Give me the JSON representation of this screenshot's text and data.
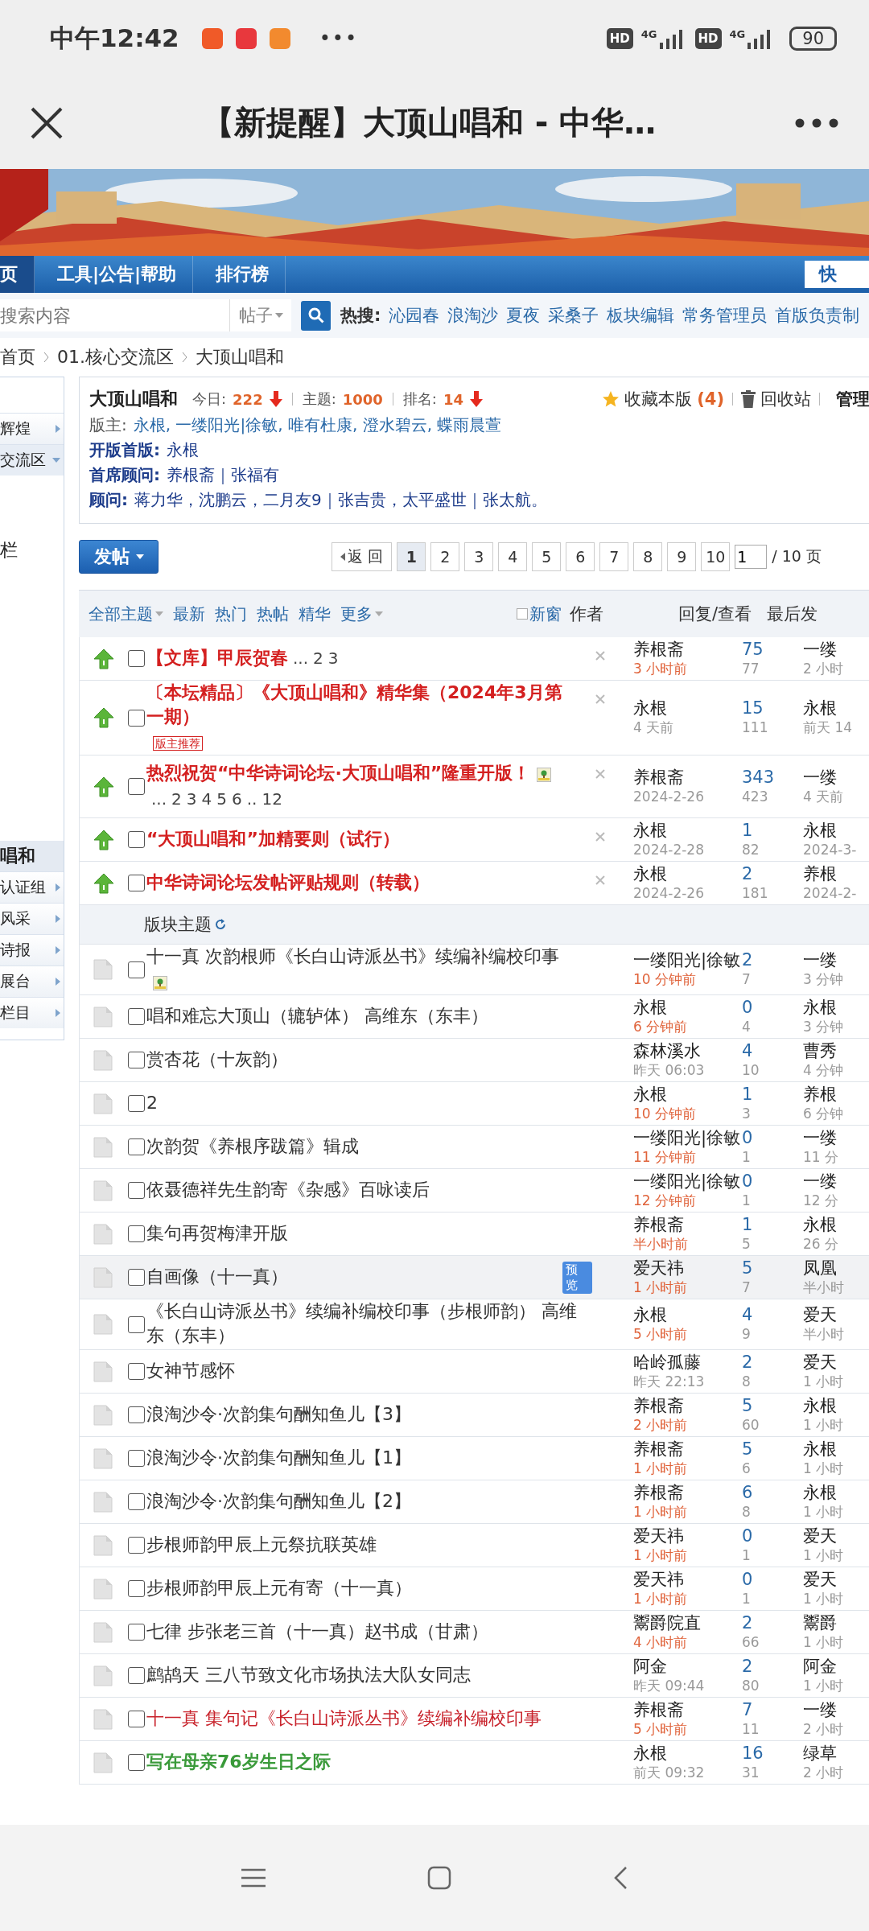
{
  "status_bar": {
    "time": "中午12:42",
    "more": "•••",
    "hd": [
      "HD",
      "HD"
    ],
    "network": [
      "4G",
      "4G"
    ],
    "battery": "90"
  },
  "browser": {
    "title": "【新提醒】大顶山唱和 - 中华…"
  },
  "nav": {
    "items": [
      {
        "label": "页",
        "selected": true
      },
      {
        "label": "工具|公告|帮助",
        "selected": false
      },
      {
        "label": "排行榜",
        "selected": false
      }
    ],
    "quick": "快"
  },
  "search": {
    "placeholder": "搜索内容",
    "type": "帖子",
    "hot_label": "热搜:",
    "hot": [
      "沁园春",
      "浪淘沙",
      "夏夜",
      "采桑子",
      "板块编辑",
      "常务管理员",
      "首版负责制"
    ]
  },
  "breadcrumb": [
    "首页",
    "01.核心交流区",
    "大顶山唱和"
  ],
  "sidebar": {
    "groups_top": [
      {
        "label": "辉煌",
        "expanded": false
      },
      {
        "label": "交流区",
        "expanded": true
      }
    ],
    "sub_items": [
      {
        "label": "栏",
        "selected": false
      },
      {
        "label": "唱和",
        "selected": true
      }
    ],
    "groups_bottom": [
      {
        "label": "认证组",
        "expanded": false
      },
      {
        "label": "风采",
        "expanded": false
      },
      {
        "label": "诗报",
        "expanded": false
      },
      {
        "label": "展台",
        "expanded": false
      },
      {
        "label": "栏目",
        "expanded": false
      }
    ]
  },
  "forum": {
    "name": "大顶山唱和",
    "today_label": "今日:",
    "today": "222",
    "topics_label": "主题:",
    "topics": "1000",
    "rank_label": "排名:",
    "rank": "14",
    "favorite": "收藏本版",
    "favorite_count": "(4)",
    "recycle": "回收站",
    "manage": "管理",
    "moderators_label": "版主:",
    "moderators": "永根, 一缕阳光|徐敏, 唯有杜康, 澄水碧云, 蝶雨晨萱",
    "founder_label": "开版首版:",
    "founder": "永根",
    "chief_label": "首席顾问:",
    "chief": "养根斋｜张福有",
    "advisors_label": "顾问:",
    "advisors": "蒋力华，沈鹏云，二月友9｜张吉贵，太平盛世｜张太航。"
  },
  "post_button": "发帖",
  "pager": {
    "back": "返 回",
    "pages": [
      {
        "label": "1",
        "selected": true
      },
      {
        "label": "2",
        "selected": false
      },
      {
        "label": "3",
        "selected": false
      },
      {
        "label": "4",
        "selected": false
      },
      {
        "label": "5",
        "selected": false
      },
      {
        "label": "6",
        "selected": false
      },
      {
        "label": "7",
        "selected": false
      },
      {
        "label": "8",
        "selected": false
      },
      {
        "label": "9",
        "selected": false
      },
      {
        "label": "10",
        "selected": false
      }
    ],
    "current": "1",
    "total": "/ 10 页"
  },
  "filters": [
    {
      "label": "全部主题",
      "dropdown": true
    },
    {
      "label": "最新",
      "dropdown": false
    },
    {
      "label": "热门",
      "dropdown": false
    },
    {
      "label": "热帖",
      "dropdown": false
    },
    {
      "label": "精华",
      "dropdown": false
    },
    {
      "label": "更多",
      "dropdown": true
    }
  ],
  "new_window": {
    "label": "新窗",
    "checked": false
  },
  "columns": {
    "author": "作者",
    "replies": "回复/查看",
    "last": "最后发"
  },
  "sticky_threads": [
    {
      "title": "【文库】甲辰贺春",
      "color": "#d42020",
      "bold": true,
      "pages": [
        "...",
        "2",
        "3"
      ],
      "author": "养根斋",
      "time": "3 小时前",
      "recent": true,
      "replies": "75",
      "views": "77",
      "last_author": "一缕",
      "last_time": "2 小时",
      "highlighted": false
    },
    {
      "title": "〔本坛精品〕《大顶山唱和》精华集（2024年3月第一期）",
      "color": "#d42020",
      "bold": true,
      "badge": {
        "kind": "recommend",
        "label": "版主推荐"
      },
      "author": "永根",
      "time": "4 天前",
      "recent": false,
      "replies": "15",
      "views": "111",
      "last_author": "永根",
      "last_time": "前天 14",
      "highlighted": false
    },
    {
      "title": "热烈祝贺“中华诗词论坛·大顶山唱和”隆重开版！",
      "color": "#d42020",
      "bold": true,
      "image": true,
      "pages": [
        "...",
        "2",
        "3",
        "4",
        "5",
        "6",
        "..",
        "12"
      ],
      "author": "养根斋",
      "time": "2024-2-26",
      "recent": false,
      "replies": "343",
      "views": "423",
      "last_author": "一缕",
      "last_time": "4 天前",
      "highlighted": false
    },
    {
      "title": "“大顶山唱和”加精要则（试行）",
      "color": "#d42020",
      "bold": true,
      "author": "永根",
      "time": "2024-2-28",
      "recent": false,
      "replies": "1",
      "views": "82",
      "last_author": "永根",
      "last_time": "2024-3-",
      "highlighted": false
    },
    {
      "title": "中华诗词论坛发帖评贴规则（转载）",
      "color": "#d42020",
      "bold": true,
      "author": "永根",
      "time": "2024-2-26",
      "recent": false,
      "replies": "2",
      "views": "181",
      "last_author": "养根",
      "last_time": "2024-2-",
      "highlighted": false
    }
  ],
  "section": "版块主题",
  "threads": [
    {
      "title": "十一真 次韵根师《长白山诗派丛书》续编补编校印事",
      "color": "#333333",
      "bold": false,
      "image": true,
      "author": "一缕阳光|徐敏",
      "time": "10 分钟前",
      "recent": true,
      "replies": "2",
      "views": "7",
      "last_author": "一缕",
      "last_time": "3 分钟",
      "highlighted": false
    },
    {
      "title": "唱和难忘大顶山（辘轳体） 高维东（东丰）",
      "color": "#333333",
      "bold": false,
      "author": "永根",
      "time": "6 分钟前",
      "recent": true,
      "replies": "0",
      "views": "4",
      "last_author": "永根",
      "last_time": "3 分钟",
      "highlighted": false
    },
    {
      "title": "赏杏花（十灰韵）",
      "color": "#333333",
      "bold": false,
      "author": "森林溪水",
      "time": "昨天 06:03",
      "recent": false,
      "replies": "4",
      "views": "10",
      "last_author": "曹秀",
      "last_time": "4 分钟",
      "highlighted": false
    },
    {
      "title": "2",
      "color": "#333333",
      "bold": false,
      "author": "永根",
      "time": "10 分钟前",
      "recent": true,
      "replies": "1",
      "views": "3",
      "last_author": "养根",
      "last_time": "6 分钟",
      "highlighted": false
    },
    {
      "title": "次韵贺《养根序跋篇》辑成",
      "color": "#333333",
      "bold": false,
      "author": "一缕阳光|徐敏",
      "time": "11 分钟前",
      "recent": true,
      "replies": "0",
      "views": "1",
      "last_author": "一缕",
      "last_time": "11 分",
      "highlighted": false
    },
    {
      "title": "依聂德祥先生韵寄《杂感》百咏读后",
      "color": "#333333",
      "bold": false,
      "author": "一缕阳光|徐敏",
      "time": "12 分钟前",
      "recent": true,
      "replies": "0",
      "views": "1",
      "last_author": "一缕",
      "last_time": "12 分",
      "highlighted": false
    },
    {
      "title": "集句再贺梅津开版",
      "color": "#333333",
      "bold": false,
      "author": "养根斋",
      "time": "半小时前",
      "recent": true,
      "replies": "1",
      "views": "5",
      "last_author": "永根",
      "last_time": "26 分",
      "highlighted": false
    },
    {
      "title": "自画像（十一真）",
      "color": "#333333",
      "bold": false,
      "badge": {
        "kind": "preview",
        "label": "预览"
      },
      "author": "爱天祎",
      "time": "1 小时前",
      "recent": true,
      "replies": "5",
      "views": "7",
      "last_author": "凤凰",
      "last_time": "半小时",
      "highlighted": true
    },
    {
      "title": "《长白山诗派丛书》续编补编校印事（步根师韵） 高维东（东丰）",
      "color": "#333333",
      "bold": false,
      "author": "永根",
      "time": "5 小时前",
      "recent": true,
      "replies": "4",
      "views": "9",
      "last_author": "爱天",
      "last_time": "半小时",
      "highlighted": false
    },
    {
      "title": "女神节感怀",
      "color": "#333333",
      "bold": false,
      "author": "哈岭孤藤",
      "time": "昨天 22:13",
      "recent": false,
      "replies": "2",
      "views": "8",
      "last_author": "爱天",
      "last_time": "1 小时",
      "highlighted": false
    },
    {
      "title": "浪淘沙令·次韵集句酬知鱼儿【3】",
      "color": "#333333",
      "bold": false,
      "author": "养根斋",
      "time": "2 小时前",
      "recent": true,
      "replies": "5",
      "views": "60",
      "last_author": "永根",
      "last_time": "1 小时",
      "highlighted": false
    },
    {
      "title": "浪淘沙令·次韵集句酬知鱼儿【1】",
      "color": "#333333",
      "bold": false,
      "author": "养根斋",
      "time": "1 小时前",
      "recent": true,
      "replies": "5",
      "views": "6",
      "last_author": "永根",
      "last_time": "1 小时",
      "highlighted": false
    },
    {
      "title": "浪淘沙令·次韵集句酬知鱼儿【2】",
      "color": "#333333",
      "bold": false,
      "author": "养根斋",
      "time": "1 小时前",
      "recent": true,
      "replies": "6",
      "views": "8",
      "last_author": "永根",
      "last_time": "1 小时",
      "highlighted": false
    },
    {
      "title": "步根师韵甲辰上元祭抗联英雄",
      "color": "#333333",
      "bold": false,
      "author": "爱天祎",
      "time": "1 小时前",
      "recent": true,
      "replies": "0",
      "views": "1",
      "last_author": "爱天",
      "last_time": "1 小时",
      "highlighted": false
    },
    {
      "title": "步根师韵甲辰上元有寄（十一真）",
      "color": "#333333",
      "bold": false,
      "author": "爱天祎",
      "time": "1 小时前",
      "recent": true,
      "replies": "0",
      "views": "1",
      "last_author": "爱天",
      "last_time": "1 小时",
      "highlighted": false
    },
    {
      "title": "七律 步张老三首（十一真）赵书成（甘肃）",
      "color": "#333333",
      "bold": false,
      "author": "鬻爵院直",
      "time": "4 小时前",
      "recent": true,
      "replies": "2",
      "views": "66",
      "last_author": "鬻爵",
      "last_time": "1 小时",
      "highlighted": false
    },
    {
      "title": "鹧鸪天 三八节致文化市场执法大队女同志",
      "color": "#333333",
      "bold": false,
      "author": "阿金",
      "time": "昨天 09:44",
      "recent": false,
      "replies": "2",
      "views": "80",
      "last_author": "阿金",
      "last_time": "1 小时",
      "highlighted": false
    },
    {
      "title": "十一真 集句记《长白山诗派丛书》续编补编校印事",
      "color": "#c8232c",
      "bold": false,
      "author": "养根斋",
      "time": "5 小时前",
      "recent": true,
      "replies": "7",
      "views": "11",
      "last_author": "一缕",
      "last_time": "2 小时",
      "highlighted": false
    },
    {
      "title": "写在母亲76岁生日之际",
      "color": "#3a9a3a",
      "bold": true,
      "author": "永根",
      "time": "前天 09:32",
      "recent": false,
      "replies": "16",
      "views": "31",
      "last_author": "绿草",
      "last_time": "2 小时",
      "highlighted": false
    }
  ]
}
